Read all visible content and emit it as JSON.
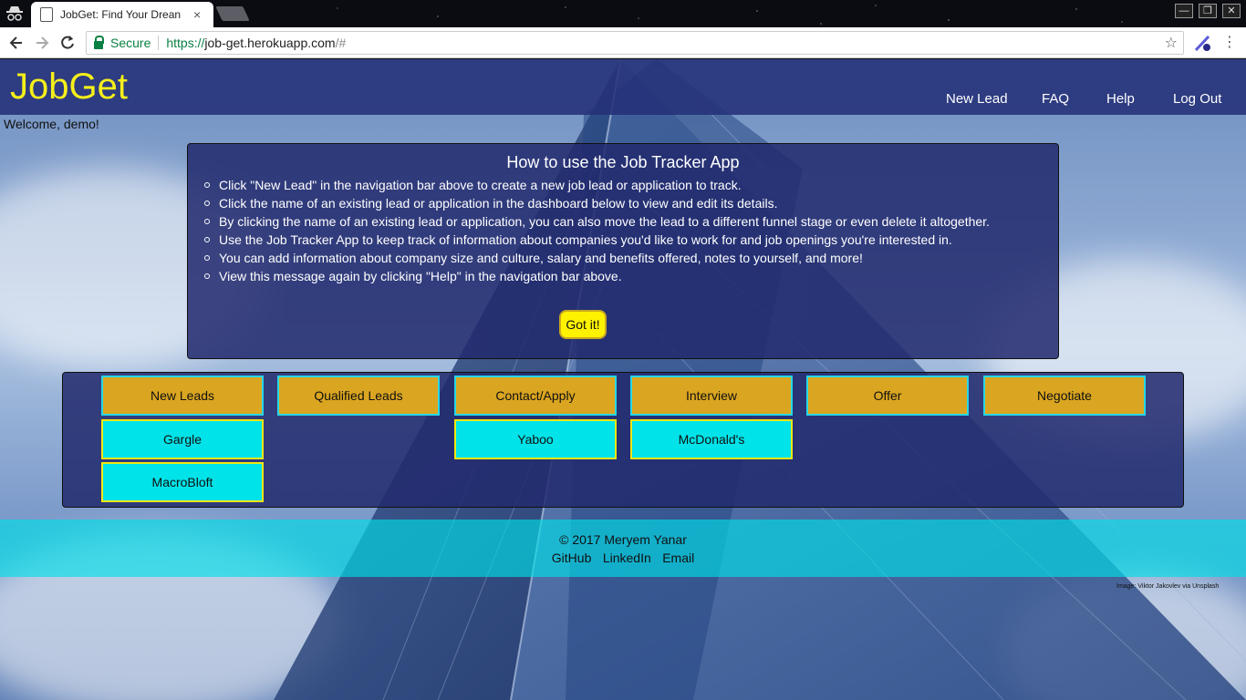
{
  "browser": {
    "tab_title": "JobGet: Find Your Drean",
    "tab_close": "×",
    "secure_label": "Secure",
    "url_scheme": "https://",
    "url_host": "job-get.herokuapp.com",
    "url_path": "/#",
    "star_icon": "☆",
    "menu_icon": "⋮",
    "win_minimize": "—",
    "win_restore": "❐",
    "win_close": "✕"
  },
  "site": {
    "brand": "JobGet",
    "nav": [
      "New Lead",
      "FAQ",
      "Help",
      "Log Out"
    ],
    "welcome": "Welcome, demo!"
  },
  "help": {
    "title": "How to use the Job Tracker App",
    "items": [
      "Click \"New Lead\" in the navigation bar above to create a new job lead or application to track.",
      "Click the name of an existing lead or application in the dashboard below to view and edit its details.",
      "By clicking the name of an existing lead or application, you can also move the lead to a different funnel stage or even delete it altogether.",
      "Use the Job Tracker App to keep track of information about companies you'd like to work for and job openings you're interested in.",
      "You can add information about company size and culture, salary and benefits offered, notes to yourself, and more!",
      "View this message again by clicking \"Help\" in the navigation bar above."
    ],
    "got_it": "Got it!"
  },
  "funnel": {
    "stages": [
      "New Leads",
      "Qualified Leads",
      "Contact/Apply",
      "Interview",
      "Offer",
      "Negotiate"
    ],
    "leads": {
      "new_leads": [
        "Gargle",
        "MacroBloft"
      ],
      "contact_apply": [
        "Yaboo"
      ],
      "interview": [
        "McDonald's"
      ]
    }
  },
  "footer": {
    "copyright": "© 2017 Meryem Yanar",
    "links": [
      "GitHub",
      "LinkedIn",
      "Email"
    ],
    "credit": "Image: Viktor Jakovlev via Unsplash"
  },
  "colors": {
    "brand_yellow": "#f5ef1a",
    "stage_gold": "#daa520",
    "lead_cyan": "#00e3e8",
    "nav_blue": "#243078"
  }
}
